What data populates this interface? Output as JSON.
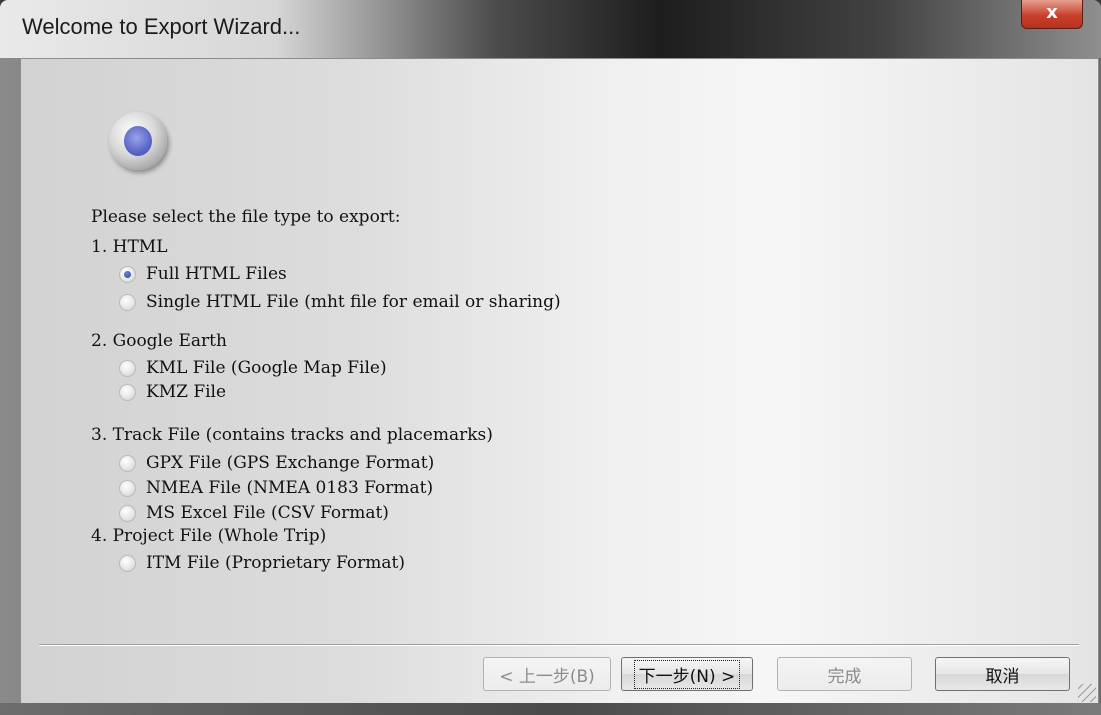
{
  "window": {
    "title": "Welcome to Export Wizard...",
    "close_label": "x"
  },
  "prompt": "Please select the file type to export:",
  "groups": [
    {
      "title": "1. HTML",
      "options": [
        {
          "label": "Full HTML Files",
          "selected": true
        },
        {
          "label": "Single HTML File (mht file for email or sharing)",
          "selected": false
        }
      ]
    },
    {
      "title": "2. Google Earth",
      "options": [
        {
          "label": "KML File (Google Map File)",
          "selected": false
        },
        {
          "label": "KMZ File",
          "selected": false
        }
      ]
    },
    {
      "title": "3. Track File (contains tracks and placemarks)",
      "options": [
        {
          "label": "GPX File (GPS Exchange Format)",
          "selected": false
        },
        {
          "label": "NMEA File (NMEA 0183 Format)",
          "selected": false
        },
        {
          "label": "MS Excel File (CSV Format)",
          "selected": false
        }
      ]
    },
    {
      "title": "4. Project File (Whole Trip)",
      "options": [
        {
          "label": "ITM File (Proprietary Format)",
          "selected": false
        }
      ]
    }
  ],
  "buttons": {
    "back": "< 上一步(B)",
    "next": "下一步(N) >",
    "finish": "完成",
    "cancel": "取消"
  }
}
